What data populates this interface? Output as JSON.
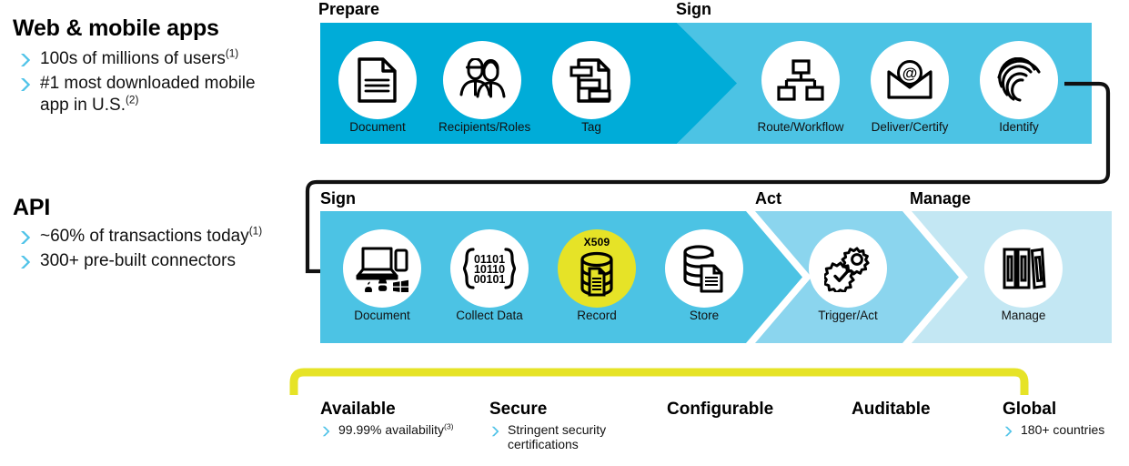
{
  "colors": {
    "cyan_dark": "#00ACD8",
    "cyan_mid": "#4CC3E4",
    "cyan_light": "#8BD5EE",
    "cyan_pale": "#C3E7F3",
    "yellow": "#E6E327",
    "bullet_blue": "#4FC3E8",
    "connector": "#111111"
  },
  "left_column": {
    "sections": [
      {
        "heading": "Web & mobile apps",
        "bullets": [
          {
            "text": "100s of millions of users",
            "sup": "(1)"
          },
          {
            "text": "#1 most downloaded mobile app in U.S.",
            "sup": "(2)"
          }
        ]
      },
      {
        "heading": "API",
        "bullets": [
          {
            "text": "~60% of transactions today",
            "sup": "(1)"
          },
          {
            "text": "300+ pre-built connectors",
            "sup": ""
          }
        ]
      }
    ]
  },
  "flow": {
    "row1": {
      "stages": [
        {
          "label": "Prepare",
          "color_key": "cyan_dark",
          "nodes": [
            {
              "caption": "Document",
              "icon": "document-icon"
            },
            {
              "caption": "Recipients/Roles",
              "icon": "people-icon"
            },
            {
              "caption": "Tag",
              "icon": "tag-document-icon"
            }
          ]
        },
        {
          "label": "Sign",
          "color_key": "cyan_mid",
          "nodes": [
            {
              "caption": "Route/Workflow",
              "icon": "org-chart-icon"
            },
            {
              "caption": "Deliver/Certify",
              "icon": "email-envelope-icon"
            },
            {
              "caption": "Identify",
              "icon": "fingerprint-icon"
            }
          ]
        }
      ]
    },
    "row2": {
      "stages": [
        {
          "label": "Sign",
          "color_key": "cyan_mid",
          "nodes": [
            {
              "caption": "Document",
              "icon": "laptop-mobile-icon"
            },
            {
              "caption": "Collect Data",
              "icon": "binary-data-icon"
            },
            {
              "caption": "Record",
              "icon": "database-record-icon",
              "badge": "X509",
              "highlight": true
            },
            {
              "caption": "Store",
              "icon": "database-store-icon"
            }
          ]
        },
        {
          "label": "Act",
          "color_key": "cyan_light",
          "nodes": [
            {
              "caption": "Trigger/Act",
              "icon": "gears-check-icon"
            }
          ]
        },
        {
          "label": "Manage",
          "color_key": "cyan_pale",
          "nodes": [
            {
              "caption": "Manage",
              "icon": "binders-icon"
            }
          ]
        }
      ]
    }
  },
  "features": [
    {
      "title": "Available",
      "bullets": [
        {
          "text": "99.99% availability",
          "sup": "(3)"
        }
      ]
    },
    {
      "title": "Secure",
      "bullets": [
        {
          "text": "Stringent security certifications",
          "sup": ""
        }
      ]
    },
    {
      "title": "Configurable",
      "bullets": []
    },
    {
      "title": "Auditable",
      "bullets": []
    },
    {
      "title": "Global",
      "bullets": [
        {
          "text": "180+ countries",
          "sup": ""
        }
      ]
    }
  ]
}
